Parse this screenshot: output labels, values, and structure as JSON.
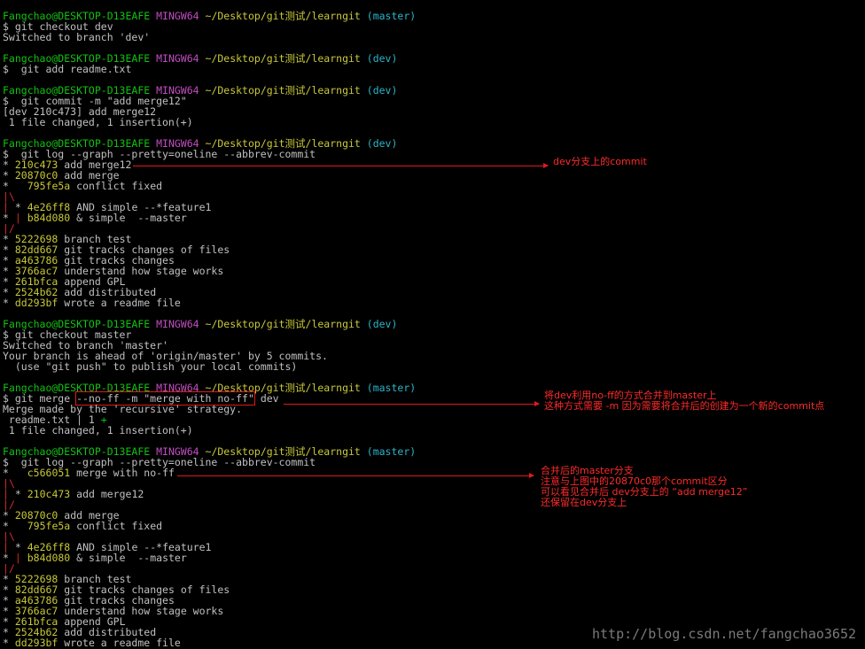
{
  "prompt": {
    "user": "Fangchao@DESKTOP-D13EAFE",
    "shell": "MINGW64",
    "path": "~/Desktop/git测试/learngit",
    "branch_master": "(master)",
    "branch_dev": "(dev)"
  },
  "cmd": {
    "checkout_dev": "$ git checkout dev",
    "add_readme": "$  git add readme.txt",
    "commit": "$  git commit -m \"add merge12\"",
    "log1": "$  git log --graph --pretty=oneline --abbrev-commit",
    "checkout_master": "$ git checkout master",
    "merge_pre": "$ git merge ",
    "merge_hl": "--no-ff -m \"merge with no-ff\"",
    "merge_post": " dev",
    "log2": "$  git log --graph --pretty=oneline --abbrev-commit"
  },
  "out": {
    "switched_dev": "Switched to branch 'dev'",
    "commit_res1": "[dev 210c473] add merge12",
    "commit_res2": " 1 file changed, 1 insertion(+)",
    "switched_master": "Switched to branch 'master'",
    "ahead1": "Your branch is ahead of 'origin/master' by 5 commits.",
    "ahead2": "  (use \"git push\" to publish your local commits)",
    "merge_res1": "Merge made by the 'recursive' strategy.",
    "merge_res2a": " readme.txt | 1 ",
    "merge_res2b": "+",
    "merge_res3": " 1 file changed, 1 insertion(+)"
  },
  "log1": [
    {
      "g": "* ",
      "h": "210c473",
      "msg": " add merge12"
    },
    {
      "g": "* ",
      "h": "20870c0",
      "msg": " add merge"
    },
    {
      "g": "*   ",
      "h": "795fe5a",
      "msg": " conflict fixed"
    },
    {
      "g": "|\\",
      "h": "",
      "msg": ""
    },
    {
      "g": "| * ",
      "h": "4e26ff8",
      "msg": " AND simple --*feature1"
    },
    {
      "g": "* | ",
      "h": "b84d080",
      "msg": " & simple  --master"
    },
    {
      "g": "|/",
      "h": "",
      "msg": ""
    },
    {
      "g": "* ",
      "h": "5222698",
      "msg": " branch test"
    },
    {
      "g": "* ",
      "h": "82dd667",
      "msg": " git tracks changes of files"
    },
    {
      "g": "* ",
      "h": "a463786",
      "msg": " git tracks changes"
    },
    {
      "g": "* ",
      "h": "3766ac7",
      "msg": " understand how stage works"
    },
    {
      "g": "* ",
      "h": "261bfca",
      "msg": " append GPL"
    },
    {
      "g": "* ",
      "h": "2524b62",
      "msg": " add distributed"
    },
    {
      "g": "* ",
      "h": "dd293bf",
      "msg": " wrote a readme file"
    }
  ],
  "log2": [
    {
      "g": "*   ",
      "h": "c566051",
      "msg": " merge with no-ff"
    },
    {
      "g": "|\\",
      "h": "",
      "msg": ""
    },
    {
      "g": "| * ",
      "h": "210c473",
      "msg": " add merge12"
    },
    {
      "g": "|/",
      "h": "",
      "msg": ""
    },
    {
      "g": "* ",
      "h": "20870c0",
      "msg": " add merge"
    },
    {
      "g": "*   ",
      "h": "795fe5a",
      "msg": " conflict fixed"
    },
    {
      "g": "|\\",
      "h": "",
      "msg": ""
    },
    {
      "g": "| * ",
      "h": "4e26ff8",
      "msg": " AND simple --*feature1"
    },
    {
      "g": "* | ",
      "h": "b84d080",
      "msg": " & simple  --master"
    },
    {
      "g": "|/",
      "h": "",
      "msg": ""
    },
    {
      "g": "* ",
      "h": "5222698",
      "msg": " branch test"
    },
    {
      "g": "* ",
      "h": "82dd667",
      "msg": " git tracks changes of files"
    },
    {
      "g": "* ",
      "h": "a463786",
      "msg": " git tracks changes"
    },
    {
      "g": "* ",
      "h": "3766ac7",
      "msg": " understand how stage works"
    },
    {
      "g": "* ",
      "h": "261bfca",
      "msg": " append GPL"
    },
    {
      "g": "* ",
      "h": "2524b62",
      "msg": " add distributed"
    },
    {
      "g": "* ",
      "h": "dd293bf",
      "msg": " wrote a readme file"
    }
  ],
  "annotations": {
    "a1": "dev分支上的commit",
    "a2_l1": "将dev利用no-ff的方式合并到master上",
    "a2_l2": "这种方式需要 -m 因为需要将合并后的创建为一个新的commit点",
    "a3_l1": "合并后的master分支",
    "a3_l2": "注意与上图中的20870c0那个commit区分",
    "a3_l3": "可以看见合并后 dev分支上的 “add merge12”",
    "a3_l4": "还保留在dev分支上"
  },
  "watermark": "http://blog.csdn.net/fangchao3652"
}
